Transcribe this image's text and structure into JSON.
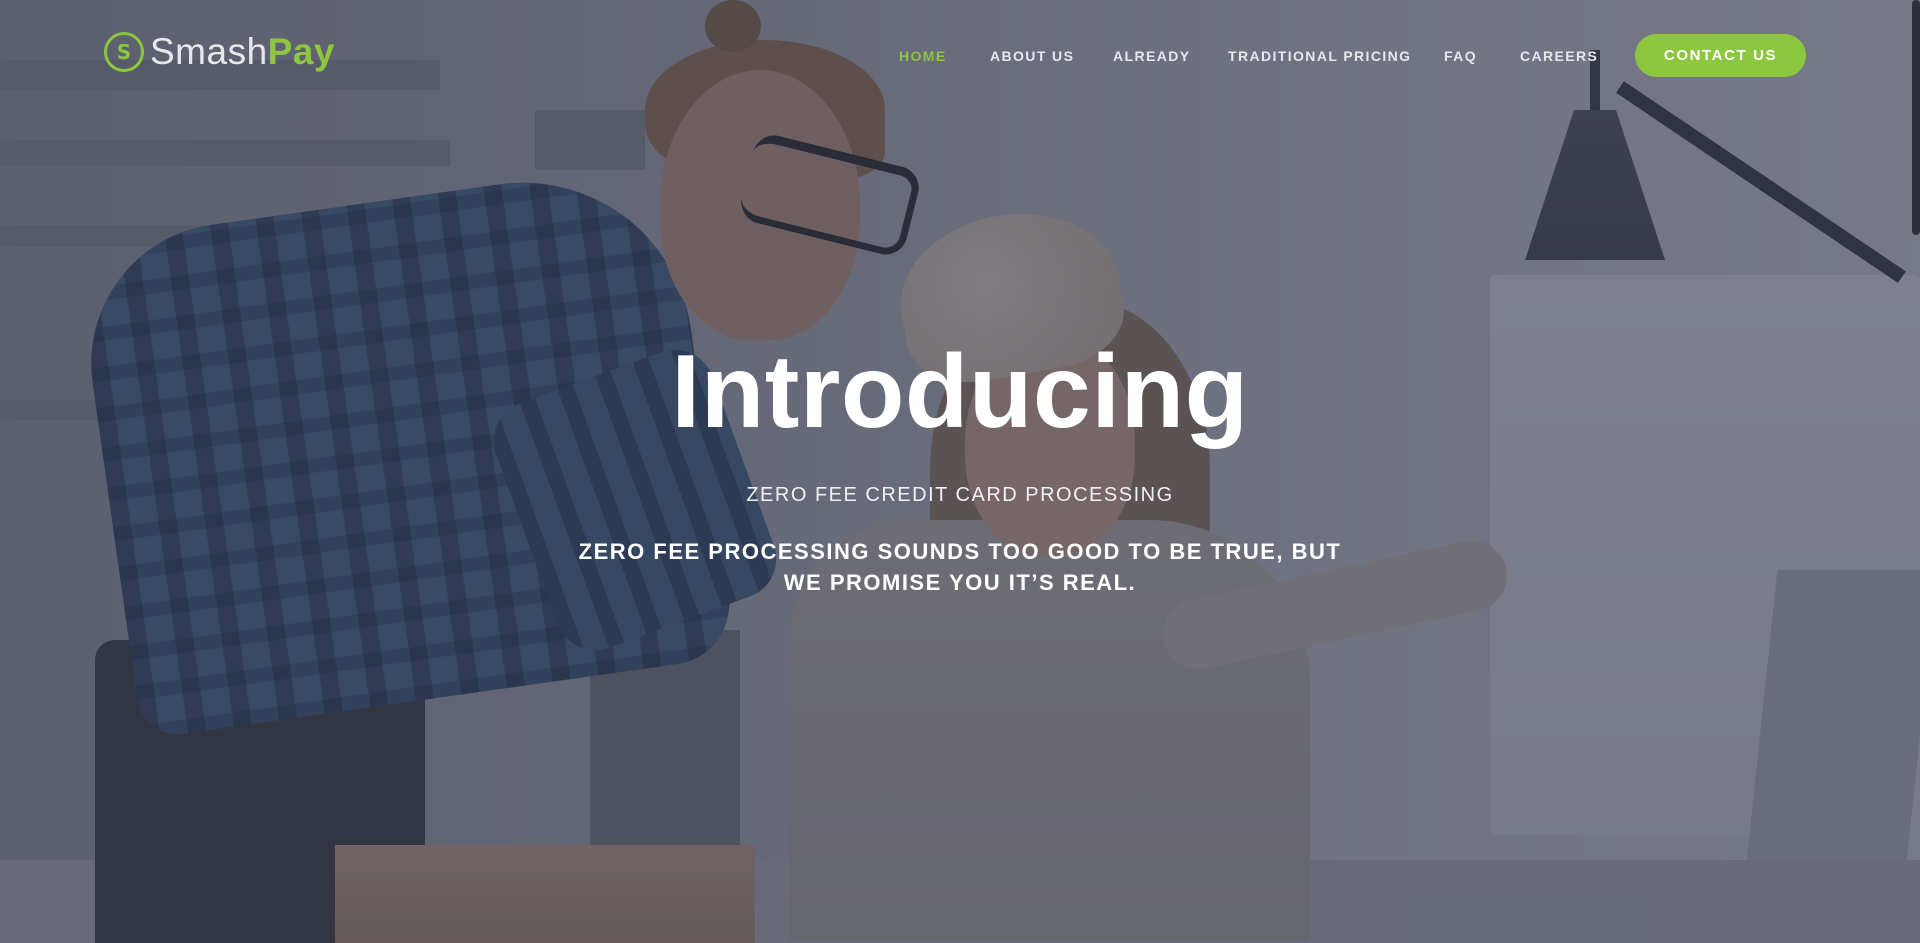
{
  "brand": {
    "name_part1": "Smash",
    "name_part2": "Pay",
    "logo_glyph": "S",
    "accent_color": "#8dc63f"
  },
  "nav": {
    "items": [
      {
        "label": "HOME",
        "active": true
      },
      {
        "label": "ABOUT US",
        "active": false
      },
      {
        "label": "ALREADY",
        "active": false
      },
      {
        "label": "TRADITIONAL PRICING",
        "active": false
      },
      {
        "label": "FAQ",
        "active": false
      },
      {
        "label": "CAREERS",
        "active": false
      }
    ],
    "cta_label": "CONTACT US"
  },
  "hero": {
    "title": "Introducing",
    "subtitle": "ZERO FEE CREDIT CARD PROCESSING",
    "description": "ZERO FEE PROCESSING SOUNDS TOO GOOD TO BE TRUE, BUT WE PROMISE YOU IT’S REAL."
  }
}
